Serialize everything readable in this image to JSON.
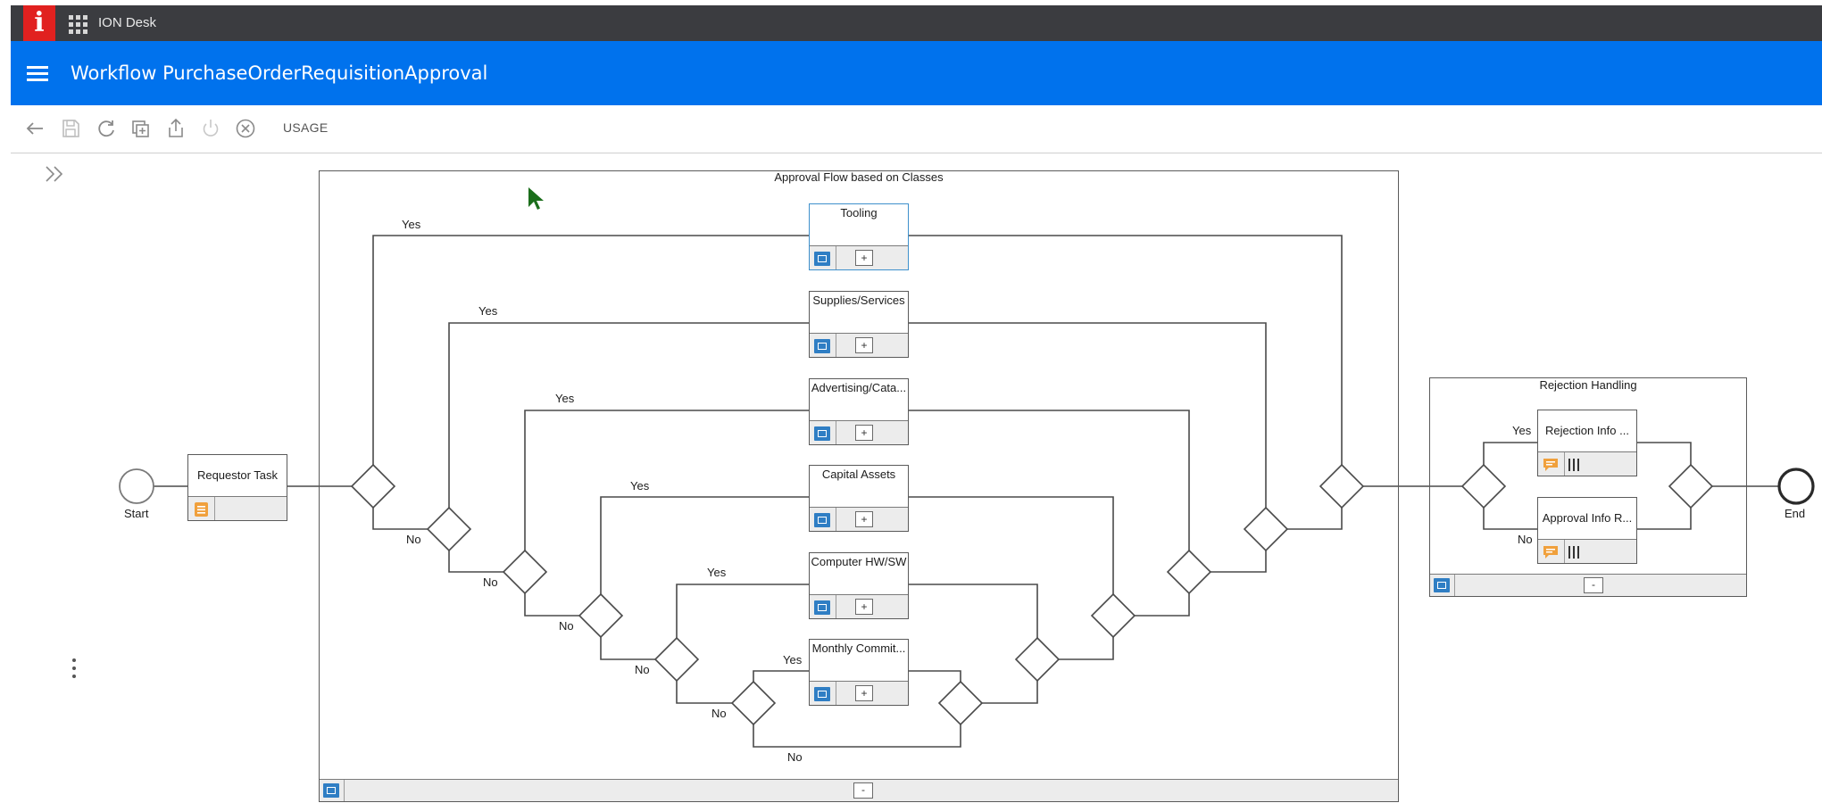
{
  "app": {
    "name": "ION Desk",
    "brand_glyph": "i",
    "brand_color": "#e1211f",
    "topbar_color": "#3b3c40"
  },
  "header": {
    "title": "Workflow PurchaseOrderRequisitionApproval",
    "color": "#0072ed"
  },
  "toolbar": {
    "icons": [
      "back-arrow-icon",
      "save-icon",
      "refresh-icon",
      "duplicate-icon",
      "export-icon",
      "power-icon",
      "close-circle-icon"
    ],
    "usage_label": "USAGE"
  },
  "diagram": {
    "start_label": "Start",
    "end_label": "End",
    "requestor_task": "Requestor Task",
    "approval_group": {
      "title": "Approval Flow based on Classes",
      "collapse_label": "-",
      "tasks": [
        {
          "name": "Tooling",
          "expand_label": "+"
        },
        {
          "name": "Supplies/Services",
          "expand_label": "+"
        },
        {
          "name": "Advertising/Cata...",
          "expand_label": "+"
        },
        {
          "name": "Capital Assets",
          "expand_label": "+"
        },
        {
          "name": "Computer HW/SW",
          "expand_label": "+"
        },
        {
          "name": "Monthly Commit...",
          "expand_label": "+"
        }
      ],
      "yes_label": "Yes",
      "no_label": "No"
    },
    "rejection_group": {
      "title": "Rejection Handling",
      "collapse_label": "-",
      "tasks": [
        {
          "name": "Rejection Info ..."
        },
        {
          "name": "Approval Info R..."
        }
      ],
      "yes_label": "Yes",
      "no_label": "No"
    }
  },
  "colors": {
    "task_accent": "#2f7ec4",
    "note_accent": "#f0a03c",
    "selected_border": "#3e90cc",
    "cursor": "#1b6e1b"
  }
}
